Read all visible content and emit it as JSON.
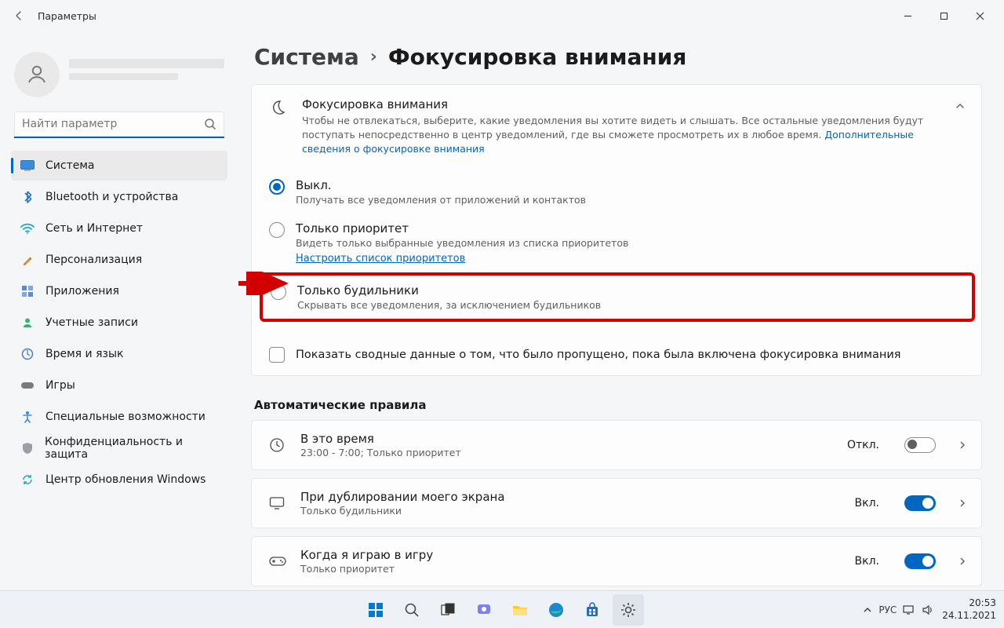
{
  "titlebar": {
    "title": "Параметры"
  },
  "search": {
    "placeholder": "Найти параметр"
  },
  "nav": {
    "items": [
      {
        "label": "Система"
      },
      {
        "label": "Bluetooth и устройства"
      },
      {
        "label": "Сеть и Интернет"
      },
      {
        "label": "Персонализация"
      },
      {
        "label": "Приложения"
      },
      {
        "label": "Учетные записи"
      },
      {
        "label": "Время и язык"
      },
      {
        "label": "Игры"
      },
      {
        "label": "Специальные возможности"
      },
      {
        "label": "Конфиденциальность и защита"
      },
      {
        "label": "Центр обновления Windows"
      }
    ]
  },
  "breadcrumb": {
    "parent": "Система",
    "current": "Фокусировка внимания"
  },
  "focus_card": {
    "title": "Фокусировка внимания",
    "description": "Чтобы не отвлекаться, выберите, какие уведомления вы хотите видеть и слышать. Все остальные уведомления будут поступать непосредственно в центр уведомлений, где вы сможете просмотреть их в любое время.  ",
    "link": "Дополнительные сведения о фокусировке внимания"
  },
  "radios": {
    "off": {
      "title": "Выкл.",
      "sub": "Получать все уведомления от приложений и контактов"
    },
    "priority": {
      "title": "Только приоритет",
      "sub": "Видеть только выбранные уведомления из списка приоритетов",
      "link": "Настроить список приоритетов"
    },
    "alarms": {
      "title": "Только будильники",
      "sub": "Скрывать все уведомления, за исключением будильников"
    }
  },
  "summary_checkbox": "Показать сводные данные о том, что было пропущено, пока была включена фокусировка внимания",
  "rules_heading": "Автоматические правила",
  "rules": {
    "time": {
      "title": "В это время",
      "sub": "23:00 - 7:00; Только приоритет",
      "state": "Откл."
    },
    "dup": {
      "title": "При дублировании моего экрана",
      "sub": "Только будильники",
      "state": "Вкл."
    },
    "game": {
      "title": "Когда я играю в игру",
      "sub": "Только приоритет",
      "state": "Вкл."
    }
  },
  "taskbar": {
    "lang": "РУС",
    "time": "20:53",
    "date": "24.11.2021"
  }
}
